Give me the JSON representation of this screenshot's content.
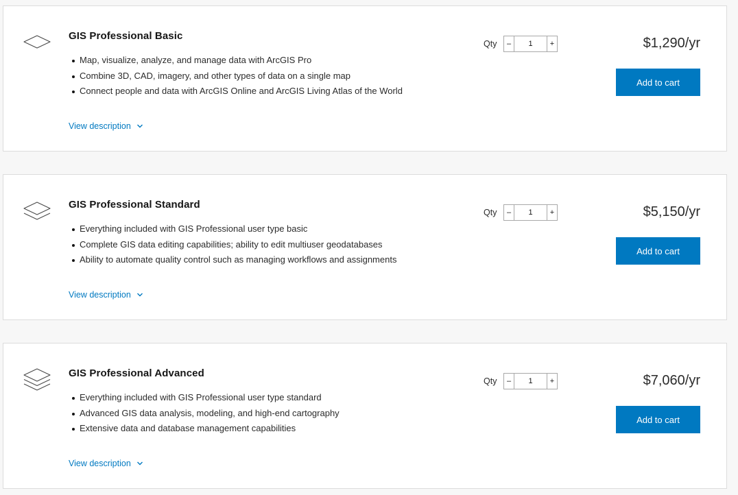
{
  "products": [
    {
      "icon": "single-layer-icon",
      "title": "GIS Professional Basic",
      "features": [
        "Map, visualize, analyze, and manage data with ArcGIS Pro",
        "Combine 3D, CAD, imagery, and other types of data on a single map",
        "Connect people and data with ArcGIS Online and ArcGIS Living Atlas of the World"
      ],
      "view_description": "View description",
      "qty_label": "Qty",
      "qty_value": "1",
      "minus_label": "–",
      "plus_label": "+",
      "price": "$1,290/yr",
      "add_to_cart": "Add to cart"
    },
    {
      "icon": "double-layer-icon",
      "title": "GIS Professional Standard",
      "features": [
        "Everything included with GIS Professional user type basic",
        "Complete GIS data editing capabilities; ability to edit multiuser geodatabases",
        "Ability to automate quality control such as managing workflows and assignments"
      ],
      "view_description": "View description",
      "qty_label": "Qty",
      "qty_value": "1",
      "minus_label": "–",
      "plus_label": "+",
      "price": "$5,150/yr",
      "add_to_cart": "Add to cart"
    },
    {
      "icon": "triple-layer-icon",
      "title": "GIS Professional Advanced",
      "features": [
        "Everything included with GIS Professional user type standard",
        "Advanced GIS data analysis, modeling, and high-end cartography",
        "Extensive data and database management capabilities"
      ],
      "view_description": "View description",
      "qty_label": "Qty",
      "qty_value": "1",
      "minus_label": "–",
      "plus_label": "+",
      "price": "$7,060/yr",
      "add_to_cart": "Add to cart"
    }
  ],
  "colors": {
    "accent": "#0079c1",
    "background": "#f7f7f7",
    "card": "#ffffff",
    "border": "#dcdcdc",
    "text": "#151515"
  }
}
